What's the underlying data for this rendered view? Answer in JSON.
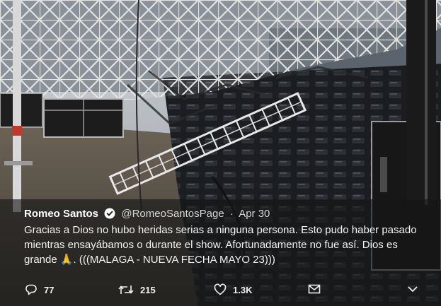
{
  "tweet": {
    "author_name": "Romeo Santos",
    "handle": "@RomeoSantosPage",
    "separator": "·",
    "date": "Apr 30",
    "text": "Gracias a Dios no hubo heridas serias a ninguna persona. Esto pudo haber pasado mientras ensayábamos o durante el show. Afortunadamente no fue así. Dios es grande 🙏. (((MALAGA - NUEVA FECHA MAYO 23)))",
    "verified": true
  },
  "actions": {
    "replies": "77",
    "retweets": "215",
    "likes": "1.3K"
  },
  "icons": {
    "reply": "reply-icon",
    "retweet": "retweet-icon",
    "like": "heart-icon",
    "dm": "envelope-icon",
    "more": "chevron-down-icon",
    "verified": "verified-badge-icon"
  },
  "colors": {
    "verified": "#ffffff",
    "card_overlay": "#161616"
  }
}
